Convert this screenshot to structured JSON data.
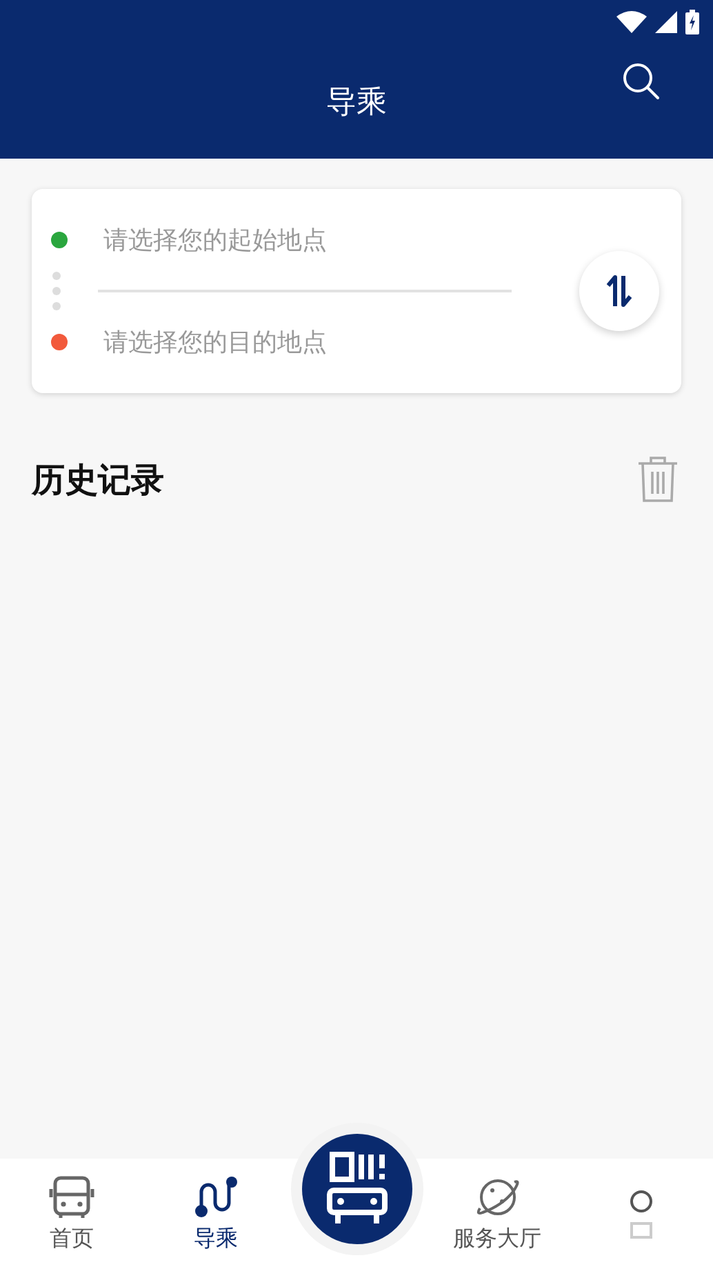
{
  "header": {
    "title": "导乘"
  },
  "route": {
    "stops": [
      {
        "placeholder": "请选择您的起始地点",
        "color": "#2aa63e"
      },
      {
        "placeholder": "请选择您的目的地点",
        "color": "#f25a3c"
      }
    ]
  },
  "history": {
    "title": "历史记录"
  },
  "nav": [
    {
      "kind": "bus",
      "label": "首页",
      "selected": false
    },
    {
      "kind": "route",
      "label": "导乘",
      "selected": true
    },
    {
      "kind": "scan"
    },
    {
      "kind": "planet",
      "label": "服务大厅",
      "selected": false
    },
    {
      "kind": "ring",
      "selected": false
    }
  ]
}
